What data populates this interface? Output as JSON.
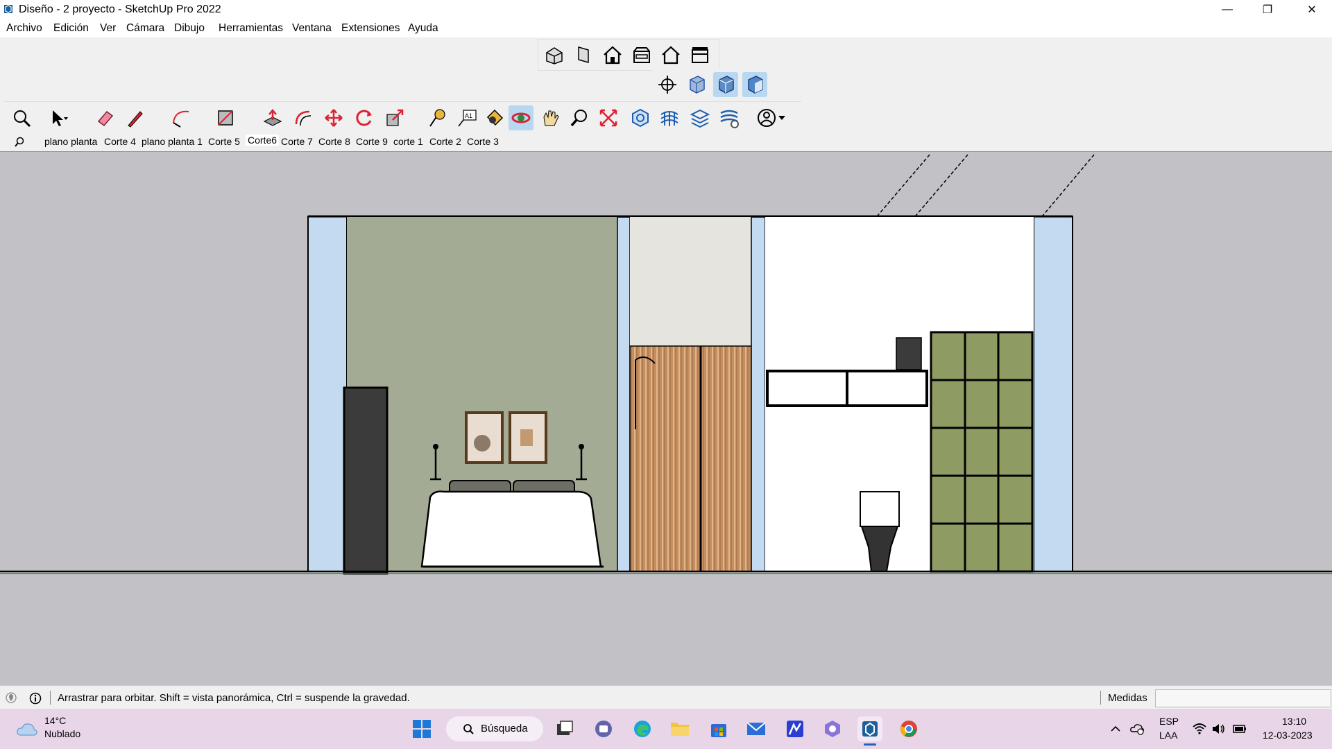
{
  "window": {
    "title": "Diseño - 2 proyecto - SketchUp Pro 2022",
    "minimize": "—",
    "maximize": "❐",
    "close": "✕"
  },
  "menu": [
    "Archivo",
    "Edición",
    "Ver",
    "Cámara",
    "Dibujo",
    "Herramientas",
    "Ventana",
    "Extensiones",
    "Ayuda"
  ],
  "toolbar_views": [
    "iso-view-icon",
    "top-view-icon",
    "front-view-icon",
    "right-view-icon",
    "back-view-icon",
    "left-view-icon"
  ],
  "toolbar_style": [
    "section-plane-icon",
    "xray-icon",
    "shaded-icon",
    "textured-icon"
  ],
  "toolbar_main": [
    "zoom-extents-icon",
    "select-icon",
    "eraser-icon",
    "pencil-icon",
    "arc-icon",
    "rectangle-icon",
    "push-pull-icon",
    "offset-icon",
    "move-icon",
    "rotate-icon",
    "scale-icon",
    "tape-measure-icon",
    "text-icon",
    "paint-bucket-icon",
    "orbit-icon",
    "pan-icon",
    "zoom-icon",
    "zoom-window-icon",
    "solid-tools-icon",
    "sandbox-icon",
    "layers-icon",
    "styles-icon",
    "account-icon"
  ],
  "scenes": [
    "plano planta",
    "Corte 4",
    "plano planta 1",
    "Corte 5",
    "Corte6",
    "Corte 7",
    "Corte 8",
    "Corte 9",
    "corte 1",
    "Corte 2",
    "Corte 3"
  ],
  "active_scene": "Corte6",
  "status": {
    "hint": "Arrastrar para orbitar. Shift = vista panorámica, Ctrl = suspende la gravedad.",
    "measures_label": "Medidas",
    "measures_value": ""
  },
  "taskbar": {
    "weather_temp": "14°C",
    "weather_desc": "Nublado",
    "search": "Búsqueda",
    "lang1": "ESP",
    "lang2": "LAA",
    "time": "13:10",
    "date": "12-03-2023"
  },
  "colors": {
    "wall_blue": "#c4daf0",
    "wall_green": "#a3ab94",
    "wood": "#c58e5f",
    "shelf_green": "#8e9c63",
    "viewport_bg": "#c2c2c6"
  }
}
